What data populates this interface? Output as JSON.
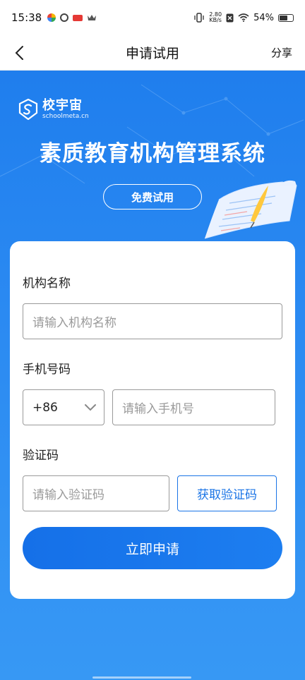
{
  "status_bar": {
    "time": "15:38",
    "net_speed_value": "2.80",
    "net_speed_unit": "KB/s",
    "battery": "54%"
  },
  "nav": {
    "title": "申请试用",
    "share": "分享"
  },
  "hero": {
    "logo_name": "校宇宙",
    "logo_domain": "schoolmeta.cn",
    "title": "素质教育机构管理系统",
    "trial_button": "免费试用"
  },
  "form": {
    "org_label": "机构名称",
    "org_placeholder": "请输入机构名称",
    "phone_label": "手机号码",
    "country_code": "+86",
    "phone_placeholder": "请输入手机号",
    "code_label": "验证码",
    "code_placeholder": "请输入验证码",
    "get_code_button": "获取验证码",
    "submit_button": "立即申请"
  },
  "colors": {
    "accent": "#1a74e6",
    "hero_bg": "#2b8af2"
  }
}
